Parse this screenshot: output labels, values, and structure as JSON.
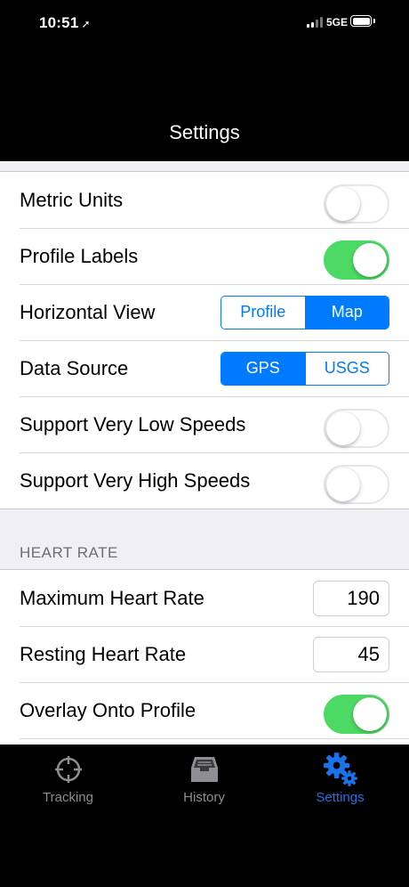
{
  "status": {
    "time": "10:51",
    "network": "5GE"
  },
  "nav": {
    "title": "Settings"
  },
  "settings": {
    "metric_units": {
      "label": "Metric Units",
      "on": false
    },
    "profile_labels": {
      "label": "Profile Labels",
      "on": true
    },
    "horizontal_view": {
      "label": "Horizontal View",
      "options": [
        "Profile",
        "Map"
      ],
      "selected": "Map"
    },
    "data_source": {
      "label": "Data Source",
      "options": [
        "GPS",
        "USGS"
      ],
      "selected": "GPS"
    },
    "low_speeds": {
      "label": "Support Very Low Speeds",
      "on": false
    },
    "high_speeds": {
      "label": "Support Very High Speeds",
      "on": false
    }
  },
  "heart_rate": {
    "header": "HEART RATE",
    "maximum": {
      "label": "Maximum Heart Rate",
      "value": "190"
    },
    "resting": {
      "label": "Resting Heart Rate",
      "value": "45"
    },
    "overlay": {
      "label": "Overlay Onto Profile",
      "on": true
    }
  },
  "tabs": [
    {
      "label": "Tracking",
      "icon": "crosshair-icon",
      "active": false
    },
    {
      "label": "History",
      "icon": "inbox-tray-icon",
      "active": false
    },
    {
      "label": "Settings",
      "icon": "gears-icon",
      "active": true
    }
  ],
  "colors": {
    "accent": "#007aff",
    "toggle_on": "#4cd964",
    "tab_active": "#1a73e8",
    "tab_inactive": "#8e8e93"
  }
}
